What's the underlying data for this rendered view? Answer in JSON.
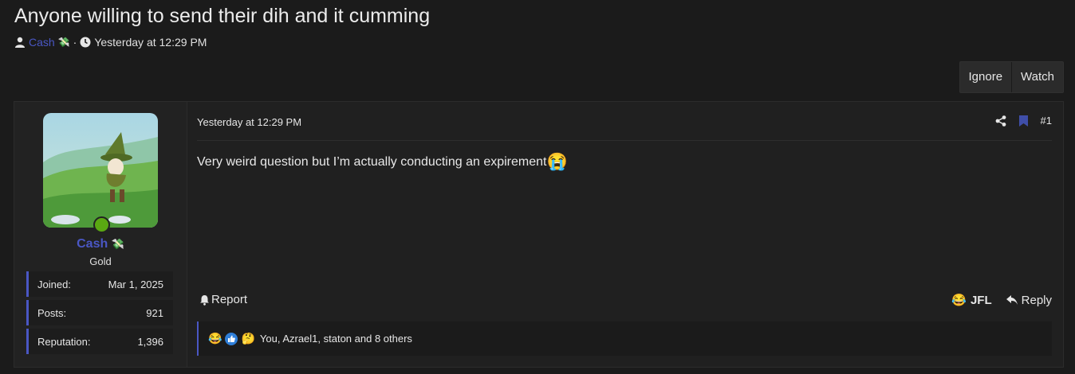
{
  "thread": {
    "title": "Anyone willing to send their dih and it cumming",
    "author": "Cash",
    "author_badge_icon": "money-with-wings-icon",
    "date": "Yesterday at 12:29 PM"
  },
  "header_buttons": {
    "ignore": "Ignore",
    "watch": "Watch"
  },
  "post": {
    "user": {
      "name": "Cash",
      "title": "Gold",
      "online": true,
      "stats": [
        {
          "label": "Joined:",
          "value": "Mar 1, 2025"
        },
        {
          "label": "Posts:",
          "value": "921"
        },
        {
          "label": "Reputation:",
          "value": "1,396"
        }
      ]
    },
    "date": "Yesterday at 12:29 PM",
    "number": "#1",
    "body": "Very weird question but I’m actually conducting an expirement",
    "body_emoji": "😭",
    "report_label": "Report",
    "reaction_label": "JFL",
    "reply_label": "Reply",
    "reactions_summary": "You, Azrael1, staton and 8 others"
  },
  "colors": {
    "accent": "#4a57c4",
    "online": "#5aa812",
    "background": "#1b1b1b"
  }
}
